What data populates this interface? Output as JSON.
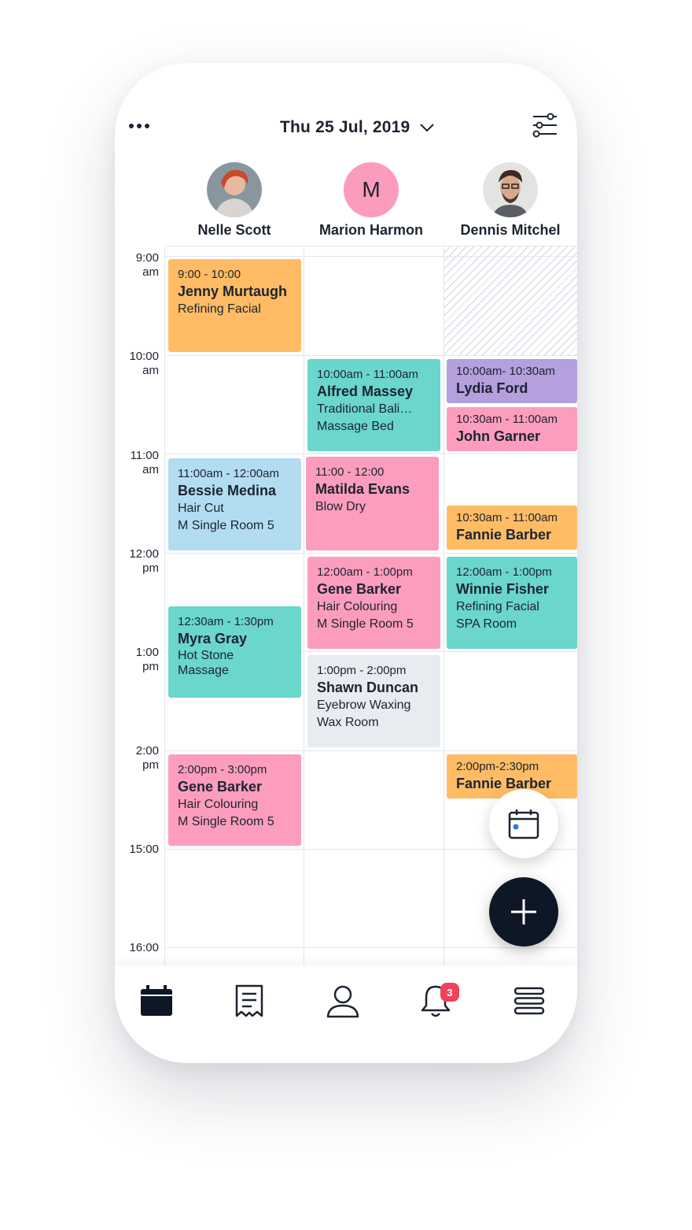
{
  "header": {
    "date": "Thu 25 Jul, 2019",
    "more_icon": "more-horizontal-icon",
    "chevron_icon": "chevron-down-icon",
    "filter_icon": "filter-sliders-icon"
  },
  "staff": [
    {
      "name": "Nelle Scott",
      "avatar": "photo"
    },
    {
      "name": "Marion Harmon",
      "avatar_letter": "M",
      "avatar_color": "#fb9cbc"
    },
    {
      "name": "Dennis Mitchel",
      "avatar": "photo"
    }
  ],
  "times": [
    {
      "line1": "9:00",
      "line2": "am"
    },
    {
      "line1": "10:00",
      "line2": "am"
    },
    {
      "line1": "11:00",
      "line2": "am"
    },
    {
      "line1": "12:00",
      "line2": "pm"
    },
    {
      "line1": "1:00",
      "line2": "pm"
    },
    {
      "line1": "2:00",
      "line2": "pm"
    },
    {
      "line1": "15:00",
      "line2": ""
    },
    {
      "line1": "16:00",
      "line2": ""
    }
  ],
  "colors": {
    "orange": "#ffbc64",
    "teal": "#6ad6cc",
    "blue": "#b2dcf2",
    "pink": "#fd9dbd",
    "purple": "#b59fdd",
    "gray": "#e8ebef",
    "navy": "#0e1726",
    "badge": "#f0425c"
  },
  "events": [
    {
      "time": "9:00 - 10:00",
      "name": "Jenny Murtaugh",
      "sub1": "Refining Facial",
      "sub2": "",
      "color": "orange"
    },
    {
      "time": "11:00am - 12:00am",
      "name": "Bessie Medina",
      "sub1": "Hair Cut",
      "sub2": "M Single Room 5",
      "color": "blue"
    },
    {
      "time": "12:30am - 1:30pm",
      "name": "Myra Gray",
      "sub1": "Hot Stone",
      "sub2": "Massage",
      "color": "teal"
    },
    {
      "time": "2:00pm - 3:00pm",
      "name": "Gene Barker",
      "sub1": "Hair Colouring",
      "sub2": "M Single Room 5",
      "color": "pink"
    },
    {
      "time": "10:00am - 11:00am",
      "name": "Alfred Massey",
      "sub1": "Traditional Bali…",
      "sub2": "Massage Bed",
      "color": "teal"
    },
    {
      "time": "11:00 - 12:00",
      "name": "Matilda Evans",
      "sub1": "Blow Dry",
      "sub2": "",
      "color": "pink"
    },
    {
      "time": "12:00am - 1:00pm",
      "name": "Gene Barker",
      "sub1": "Hair Colouring",
      "sub2": "M Single Room 5",
      "color": "pink"
    },
    {
      "time": "1:00pm - 2:00pm",
      "name": "Shawn Duncan",
      "sub1": "Eyebrow Waxing",
      "sub2": "Wax Room",
      "color": "gray"
    },
    {
      "time": "10:00am- 10:30am",
      "name": "Lydia Ford",
      "sub1": "",
      "sub2": "",
      "color": "purple"
    },
    {
      "time": "10:30am - 11:00am",
      "name": "John Garner",
      "sub1": "",
      "sub2": "",
      "color": "pink"
    },
    {
      "time": "10:30am - 11:00am",
      "name": "Fannie Barber",
      "sub1": "",
      "sub2": "",
      "color": "orange"
    },
    {
      "time": "12:00am - 1:00pm",
      "name": "Winnie Fisher",
      "sub1": "Refining Facial",
      "sub2": "SPA Room",
      "color": "teal"
    },
    {
      "time": "2:00pm-2:30pm",
      "name": "Fannie Barber",
      "sub1": "",
      "sub2": "",
      "color": "orange"
    }
  ],
  "fab": {
    "calendar_icon": "calendar-icon",
    "add_icon": "plus-icon"
  },
  "bottom_nav": [
    {
      "icon": "calendar-icon",
      "active": true
    },
    {
      "icon": "receipt-icon"
    },
    {
      "icon": "user-icon"
    },
    {
      "icon": "bell-icon",
      "badge": "3"
    },
    {
      "icon": "menu-icon"
    }
  ]
}
